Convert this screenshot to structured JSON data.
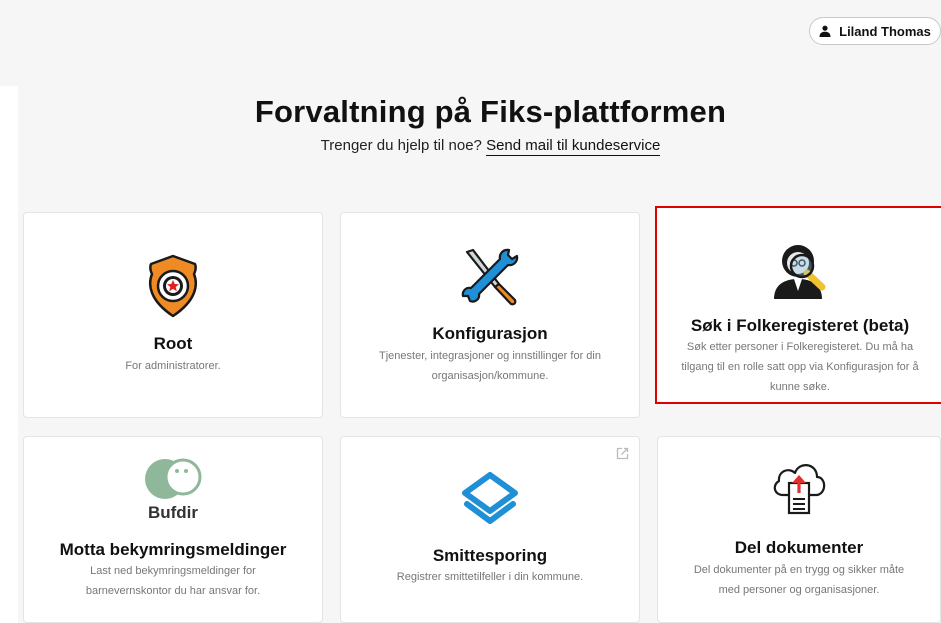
{
  "header": {
    "user_name": "Liland Thomas"
  },
  "hero": {
    "title": "Forvaltning på Fiks-plattformen",
    "help_text": "Trenger du hjelp til noe?",
    "help_link": "Send mail til kundeservice"
  },
  "cards": [
    {
      "title": "Root",
      "description": "For administratorer.",
      "icon": "police-badge-icon"
    },
    {
      "title": "Konfigurasjon",
      "description": "Tjenester, integrasjoner og innstillinger for din organisasjon/kommune.",
      "icon": "tools-icon"
    },
    {
      "title": "Søk i Folkeregisteret (beta)",
      "description": "Søk etter personer i Folkeregisteret. Du må ha tilgang til en rolle satt opp via Konfigurasjon for å kunne søke.",
      "icon": "person-search-icon"
    },
    {
      "title": "Motta bekymringsmeldinger",
      "description": "Last ned bekymringsmeldinger for barnevernskontor du har ansvar for.",
      "icon": "bufdir-logo",
      "logo_text": "Bufdir"
    },
    {
      "title": "Smittesporing",
      "description": "Registrer smittetilfeller i din kommune.",
      "icon": "layers-icon",
      "external": true
    },
    {
      "title": "Del dokumenter",
      "description": "Del dokumenter på en trygg og sikker måte med personer og organisasjoner.",
      "icon": "cloud-upload-icon"
    }
  ],
  "colors": {
    "highlight_border": "#e00000",
    "accent_orange": "#f08a24",
    "accent_blue": "#1f8fd6",
    "bufdir_green": "#8fb79a"
  }
}
